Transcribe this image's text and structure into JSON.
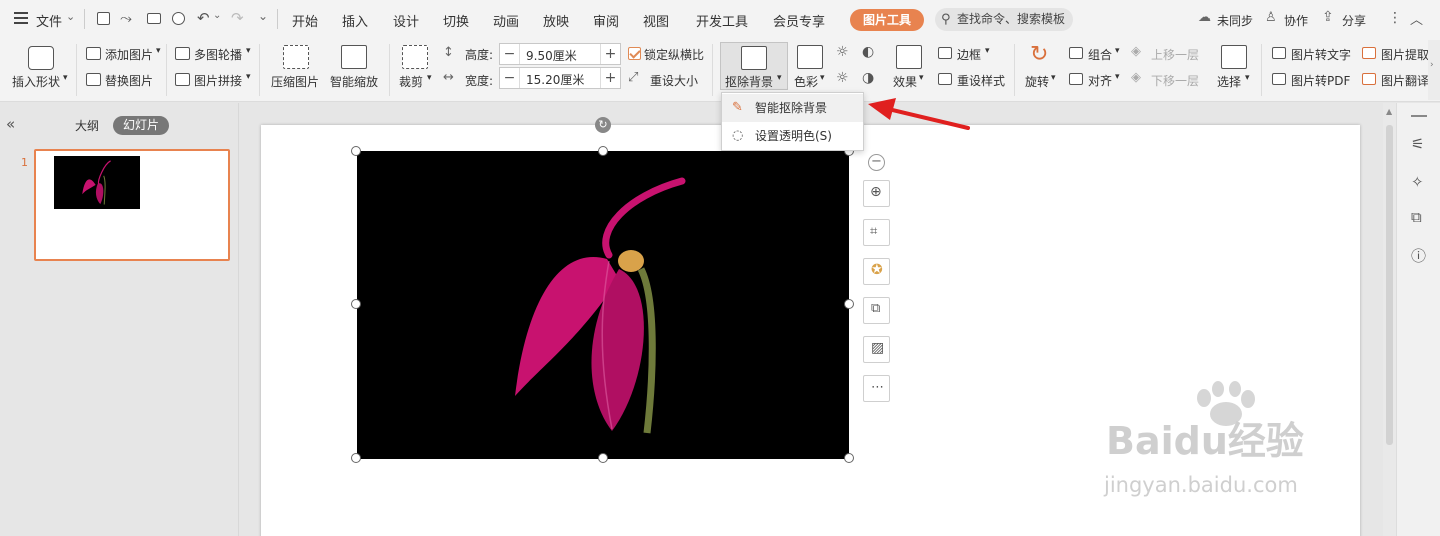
{
  "topbar": {
    "file_menu": "文件",
    "tabs": [
      "开始",
      "插入",
      "设计",
      "切换",
      "动画",
      "放映",
      "审阅",
      "视图",
      "开发工具",
      "会员专享"
    ],
    "active_tab": "图片工具",
    "search_placeholder": "查找命令、搜索模板",
    "unsynced": "未同步",
    "collaborate": "协作",
    "share": "分享"
  },
  "ribbon": {
    "insert_shape": "插入形状",
    "add_picture": "添加图片",
    "replace_picture": "替换图片",
    "multi_carousel": "多图轮播",
    "picture_collage": "图片拼接",
    "compress_picture": "压缩图片",
    "smart_zoom": "智能缩放",
    "crop": "裁剪",
    "height_label": "高度:",
    "height_value": "9.50厘米",
    "width_label": "宽度:",
    "width_value": "15.20厘米",
    "lock_ratio": "锁定纵横比",
    "reset_size": "重设大小",
    "remove_background": "抠除背景",
    "color": "色彩",
    "effects": "效果",
    "border": "边框",
    "reset_style": "重设样式",
    "rotate": "旋转",
    "group": "组合",
    "align": "对齐",
    "bring_forward": "上移一层",
    "send_backward": "下移一层",
    "select": "选择",
    "pic_to_text": "图片转文字",
    "pic_to_pdf": "图片转PDF",
    "pic_extract": "图片提取",
    "pic_translate": "图片翻译"
  },
  "dropdown": {
    "items": [
      "智能抠除背景",
      "设置透明色(S)"
    ]
  },
  "sidebar": {
    "outline": "大纲",
    "slides": "幻灯片",
    "slide_number": "1"
  },
  "watermark": {
    "brand": "Baidu经验",
    "url": "jingyan.baidu.com"
  },
  "colors": {
    "accent": "#e8834f",
    "flower": "#c8126f",
    "arrow": "#e0201f"
  }
}
